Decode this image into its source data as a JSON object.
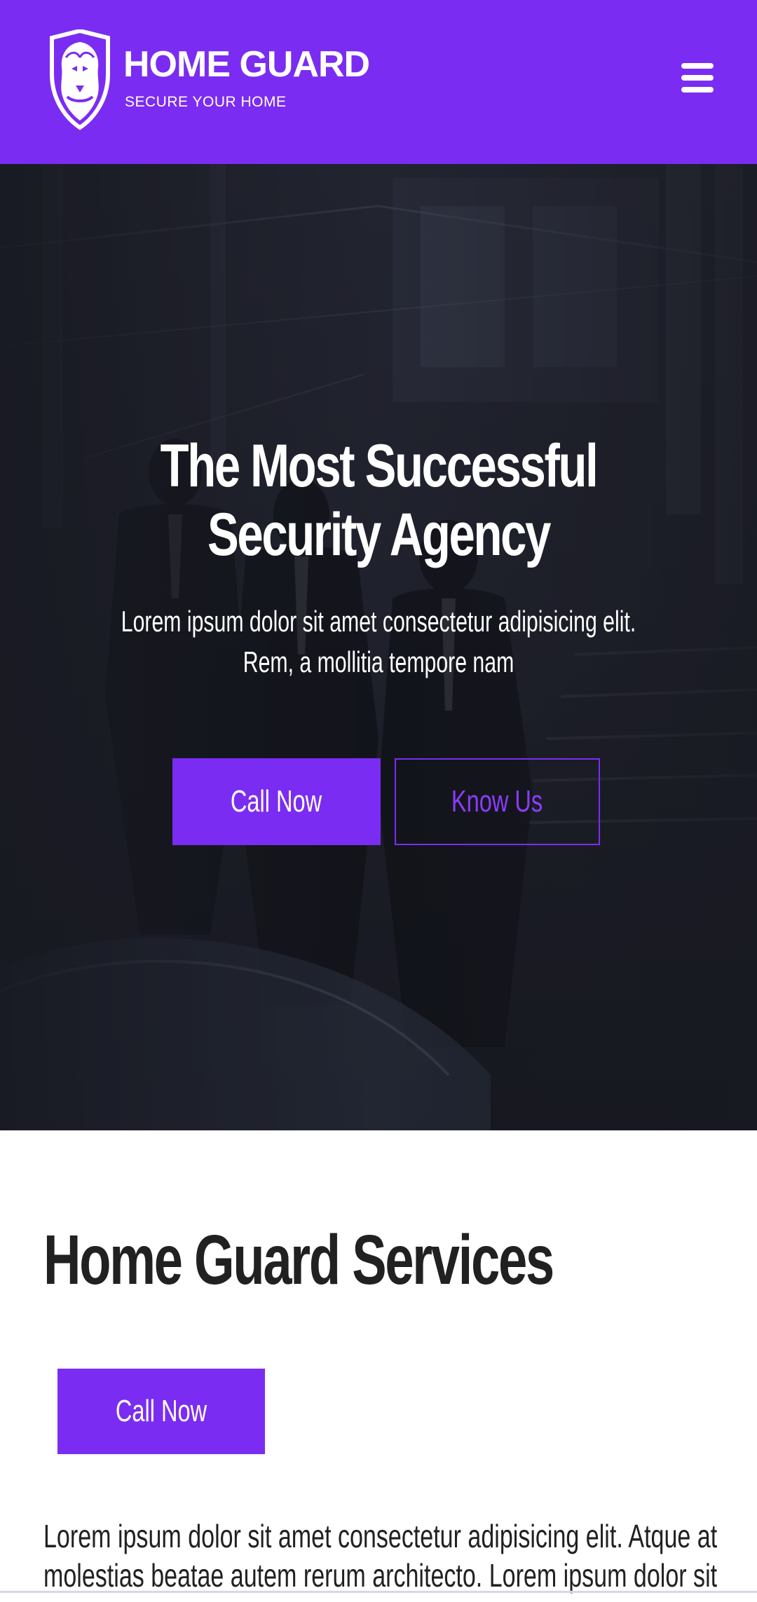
{
  "header": {
    "brand_name": "HOME GUARD",
    "brand_tagline": "SECURE YOUR HOME",
    "logo_icon": "lion-shield-icon",
    "menu_icon": "hamburger-menu-icon",
    "background_color": "#7b2cf2"
  },
  "hero": {
    "title": "The Most Successful Security Agency",
    "subtitle": "Lorem ipsum dolor sit amet consectetur adipisicing elit. Rem, a mollitia tempore nam",
    "primary_button": "Call Now",
    "secondary_button": "Know Us",
    "accent_color": "#7b2cf2"
  },
  "services": {
    "title": "Home Guard Services",
    "call_button": "Call Now",
    "description": "Lorem ipsum dolor sit amet consectetur adipisicing elit. Atque at molestias beatae autem rerum architecto. Lorem ipsum dolor sit"
  }
}
